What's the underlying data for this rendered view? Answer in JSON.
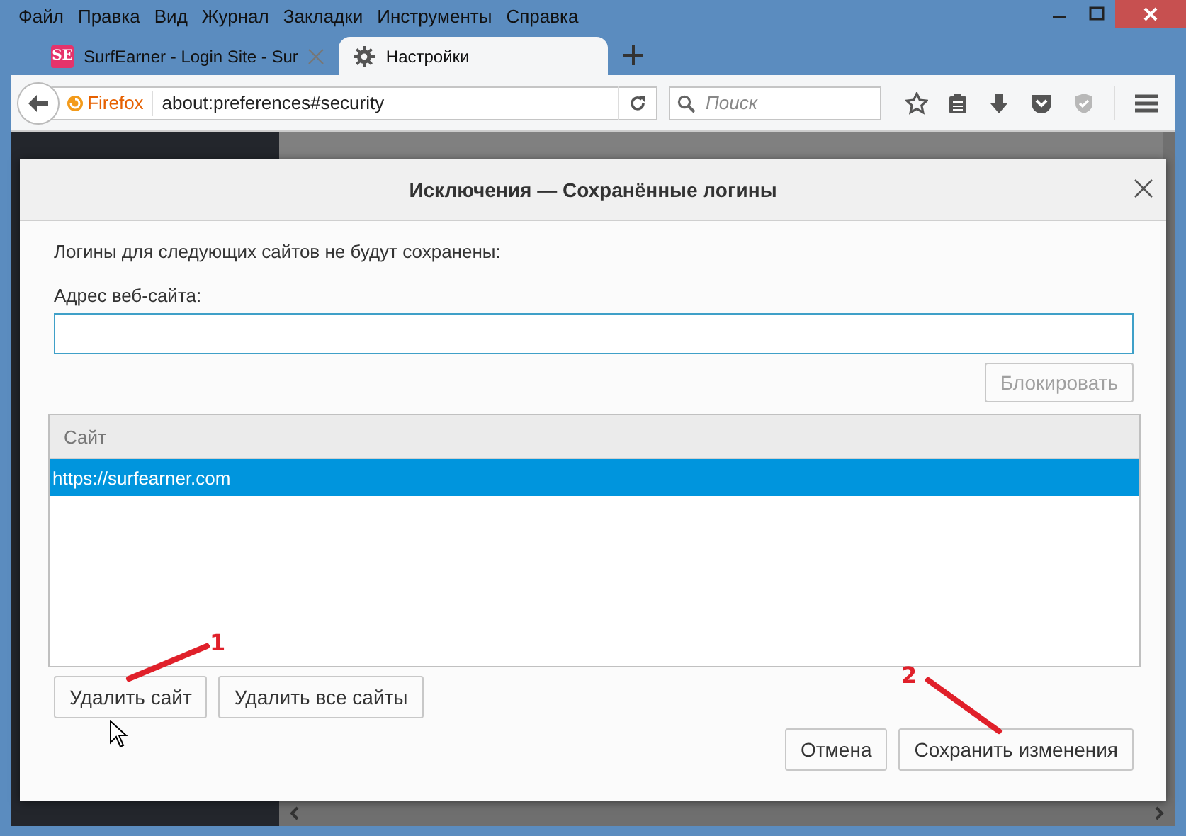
{
  "menu_bar": {
    "items": [
      "Файл",
      "Правка",
      "Вид",
      "Журнал",
      "Закладки",
      "Инструменты",
      "Справка"
    ]
  },
  "tabs": [
    {
      "label": "SurfEarner - Login Site - Sur",
      "selected": false,
      "kind": "site",
      "favicon_text": "SE"
    },
    {
      "label": "Настройки",
      "selected": true,
      "kind": "settings"
    }
  ],
  "address_bar": {
    "identity": "Firefox",
    "url": "about:preferences#security"
  },
  "search": {
    "placeholder": "Поиск"
  },
  "dialog": {
    "title": "Исключения — Сохранённые логины",
    "description": "Логины для следующих сайтов не будут сохранены:",
    "address_label": "Адрес веб-сайта:",
    "block_button": {
      "label": "Блокировать",
      "disabled": true
    },
    "table": {
      "columns": [
        "Сайт"
      ],
      "rows": [
        {
          "site": "https://surfearner.com",
          "selected": true
        }
      ]
    },
    "remove_buttons": [
      "Удалить сайт",
      "Удалить все сайты"
    ],
    "footer_buttons": [
      "Отмена",
      "Сохранить изменения"
    ]
  },
  "annotations": [
    {
      "label": "1"
    },
    {
      "label": "2"
    }
  ]
}
